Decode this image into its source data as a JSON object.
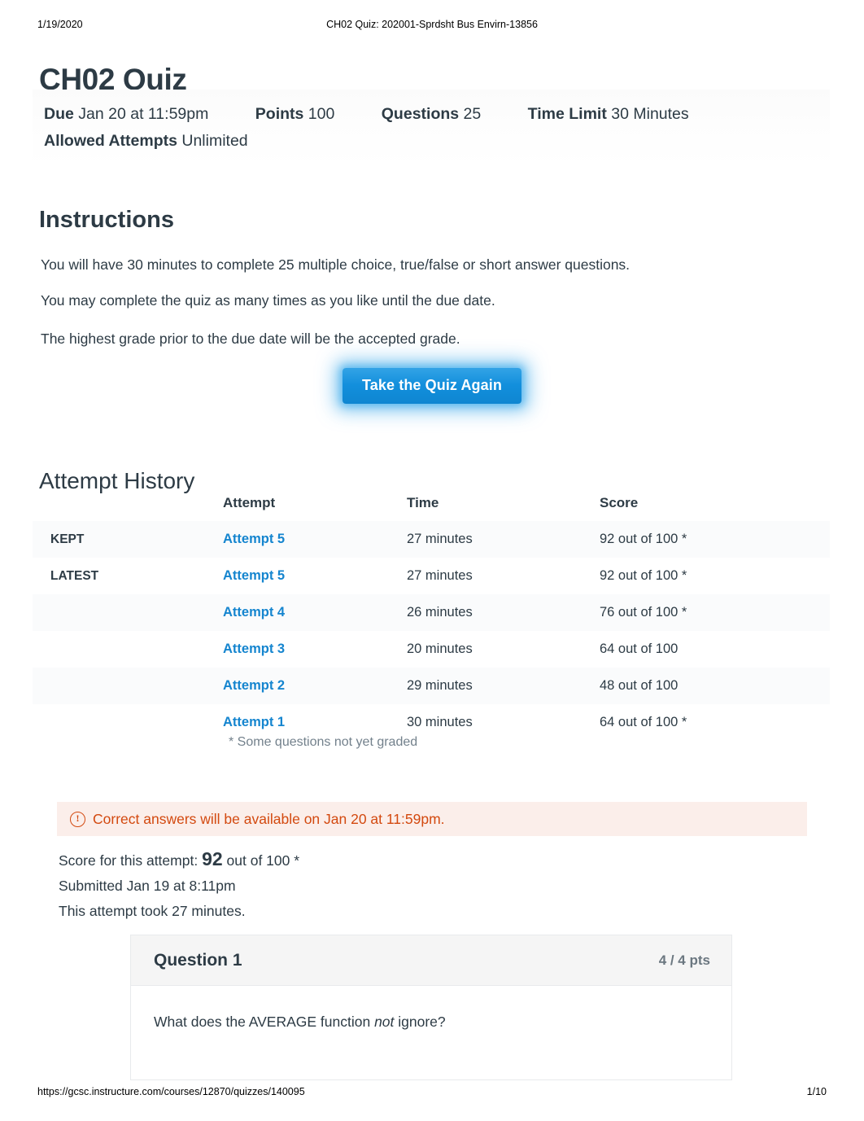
{
  "print_header": {
    "date": "1/19/2020",
    "document_title": "CH02 Quiz: 202001-Sprdsht Bus Envirn-13856"
  },
  "print_footer": {
    "url": "https://gcsc.instructure.com/courses/12870/quizzes/140095",
    "page": "1/10"
  },
  "quiz": {
    "title": "CH02 Quiz",
    "meta": {
      "due_label": "Due",
      "due_value": "Jan 20 at 11:59pm",
      "points_label": "Points",
      "points_value": "100",
      "questions_label": "Questions",
      "questions_value": "25",
      "time_limit_label": "Time Limit",
      "time_limit_value": "30 Minutes",
      "allowed_attempts_label": "Allowed Attempts",
      "allowed_attempts_value": "Unlimited"
    }
  },
  "instructions": {
    "heading": "Instructions",
    "paragraphs": [
      "You will have 30  minutes to complete 25 multiple choice, true/false or short answer questions.",
      "You may complete the quiz as many times as you like until the due date.",
      "The highest grade prior to the due date will be the accepted grade."
    ]
  },
  "take_quiz_button": {
    "label": "Take the Quiz Again",
    "color": "#128fdc"
  },
  "attempt_history": {
    "heading": "Attempt History",
    "columns": [
      "",
      "Attempt",
      "Time",
      "Score"
    ],
    "rows": [
      {
        "tag": "KEPT",
        "attempt": "Attempt 5",
        "time": "27 minutes",
        "score": "92 out of 100 *"
      },
      {
        "tag": "LATEST",
        "attempt": "Attempt 5",
        "time": "27 minutes",
        "score": "92 out of 100 *"
      },
      {
        "tag": "",
        "attempt": "Attempt 4",
        "time": "26 minutes",
        "score": "76 out of 100 *"
      },
      {
        "tag": "",
        "attempt": "Attempt 3",
        "time": "20 minutes",
        "score": "64 out of 100"
      },
      {
        "tag": "",
        "attempt": "Attempt 2",
        "time": "29 minutes",
        "score": "48 out of 100"
      },
      {
        "tag": "",
        "attempt": "Attempt 1",
        "time": "30 minutes",
        "score": "64 out of 100 *"
      }
    ],
    "footnote": "* Some questions not yet graded",
    "link_color": "#1585cf"
  },
  "alert": {
    "icon": "warning-circle-icon",
    "text": "Correct answers will be available on Jan 20 at 11:59pm.",
    "color": "#d3490f",
    "background": "#fbeeea"
  },
  "attempt_summary": {
    "score_prefix": "Score for this attempt:",
    "score_value": "92",
    "score_suffix": "out of 100 *",
    "submitted": "Submitted Jan 19 at 8:11pm",
    "duration": "This attempt took 27 minutes."
  },
  "question": {
    "title": "Question 1",
    "points": "4 / 4 pts",
    "text_before_em": "What does the AVERAGE function ",
    "text_em": "not",
    "text_after_em": " ignore?"
  }
}
